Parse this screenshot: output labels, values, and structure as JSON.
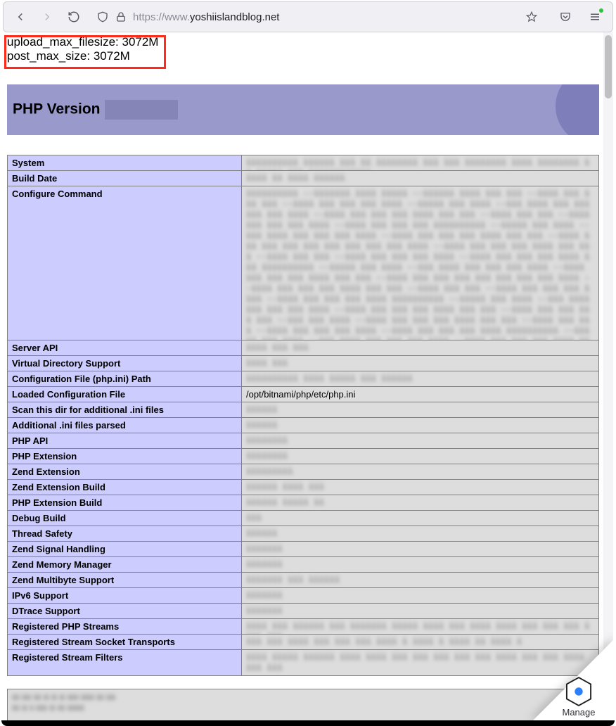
{
  "browser": {
    "url_protocol": "https://",
    "url_prefix": "www.",
    "url_domain": "yoshiislandblog.net"
  },
  "top_output": {
    "line1": "upload_max_filesize: 3072M",
    "line2": "post_max_size: 3072M"
  },
  "phpinfo": {
    "title": "PHP Version",
    "rows": [
      {
        "key": "System",
        "fill": "iiiiiiiiii iiiiii iii ii iiiiiiii iii iii iiiiiiii iiii iiiiiiii ii iiiii iii iiiiiiiiiiii.",
        "h": "h1"
      },
      {
        "key": "Build Date",
        "fill": "iiii ii iiii iiiiii",
        "h": "h1"
      },
      {
        "key": "Configure Command",
        "fill_big": true
      },
      {
        "key": "Server API",
        "fill": "iiii iii iii",
        "h": "h1"
      },
      {
        "key": "Virtual Directory Support",
        "fill": "iiii iii",
        "h": "h1"
      },
      {
        "key": "Configuration File (php.ini) Path",
        "fill": "iiiiiiiiii iiii iiiii iii iiiiii",
        "h": "h1"
      },
      {
        "key": "Loaded Configuration File",
        "value": "/opt/bitnami/php/etc/php.ini"
      },
      {
        "key": "Scan this dir for additional .ini files",
        "fill": "iiiiii",
        "h": "h1"
      },
      {
        "key": "Additional .ini files parsed",
        "fill": "iiiiii",
        "h": "h1"
      },
      {
        "key": "PHP API",
        "fill": "iiiiiiii",
        "h": "h1"
      },
      {
        "key": "PHP Extension",
        "fill": "iiiiiiii",
        "h": "h1"
      },
      {
        "key": "Zend Extension",
        "fill": "iiiiiiiii",
        "h": "h1"
      },
      {
        "key": "Zend Extension Build",
        "fill": "iiiiii iiii iii",
        "h": "h1"
      },
      {
        "key": "PHP Extension Build",
        "fill": "iiiiii iiiii ii",
        "h": "h1"
      },
      {
        "key": "Debug Build",
        "fill": "iii",
        "h": "h1"
      },
      {
        "key": "Thread Safety",
        "fill": "iiiiii",
        "h": "h1"
      },
      {
        "key": "Zend Signal Handling",
        "fill": "iiiiiii",
        "h": "h1"
      },
      {
        "key": "Zend Memory Manager",
        "fill": "iiiiiii",
        "h": "h1"
      },
      {
        "key": "Zend Multibyte Support",
        "fill": "iiiiiii iii iiiiii",
        "h": "h1"
      },
      {
        "key": "IPv6 Support",
        "fill": "iiiiiii",
        "h": "h1"
      },
      {
        "key": "DTrace Support",
        "fill": "iiiiiii",
        "h": "h1"
      },
      {
        "key": "Registered PHP Streams",
        "fill": "iiii iii iiiiii iii iiiiiii iiiii iiii iii iiii iiii iii iii iii iiii iii",
        "h": "h1"
      },
      {
        "key": "Registered Stream Socket Transports",
        "fill": "iii iii iiii iii iii iii iiii i iiii i iiii ii iiii i",
        "h": "h1"
      },
      {
        "key": "Registered Stream Filters",
        "fill": "iiii iiiii iiiiii iiii iiii iii iii iii iii iii iiii iii iii iiii iii iii",
        "h": "h2"
      }
    ],
    "configure_fill": "iiiiiiiiii --iiiiiii iiii iiiii --iiiiii iiii iii iii --iiii iii iii iii --iiii iii iii iii iiii --iiiii iii iiii --iii iiii iii\niii iii iii iiii --iiii iii iii iii iiii iii iii --iiii iii iii --iiii iii iii iii iiii --iiii iii iii iii\niiiiiiiiii --iiiii iii iiii --iii iiii iii iii iii iiii --iiii iii iii iii iiii iii iii --iiii iii iii iii iii iii\niii iii iii iiii --iiii iii iii iii iiii iii iii --iiii iii iii --iiii iii iii iii iiii --iiii iii iii iii iiii iii\niiiiiiiiii --iiiii iii iiii --iii iiii iii iii iii iiii --iiii iii iii iii iiii iii iii --iiii iii iii iii iii\niii iii iii iiii --iiii iii iii iii iiii iii iii --iiii iii iii --iiii iii iii iii iiii --iiii iii iii iii iiii\niiiiiiiiii --iiiii iii iiii --iii iiii iii iii iii iiii --iiii iii iii iii iiii iii iii --iiii iii iii iii\niii --iii iii iiii --iiii iii iii iii iiii iii iii --iiii iii iii --iiii iii iii iii iiii --iiii iii iii iii iiii\niiiiiiiiii --iiiii iii iiii --iii iiii iii iii iii iiii --iiii iii iii iii iiii iii iii --iiii iii iii iii iii\n--iii iii iiii --iiii iii iii iii iiii iii iii --iiii iii iii --iiii iii iii iii iiii --iiii iii iii iii iii\n--iii iii iiii iiii --iiii iii iii iii iiii iii iii --iiii iii iii --iiii iii iii iii iiii --iiii iii\n--iiii iii --iiii iii iii iii iiii iii iii --iiii iii iii --iiii iii iii iii iiii --iiii iii iii iii iiii\n--iiiiii iiii --iiii iii iii iii iiii iii iii --iiii iii iii\niii iii iiii iiiiiiiiii iiii"
  },
  "manage": {
    "label": "Manage"
  }
}
